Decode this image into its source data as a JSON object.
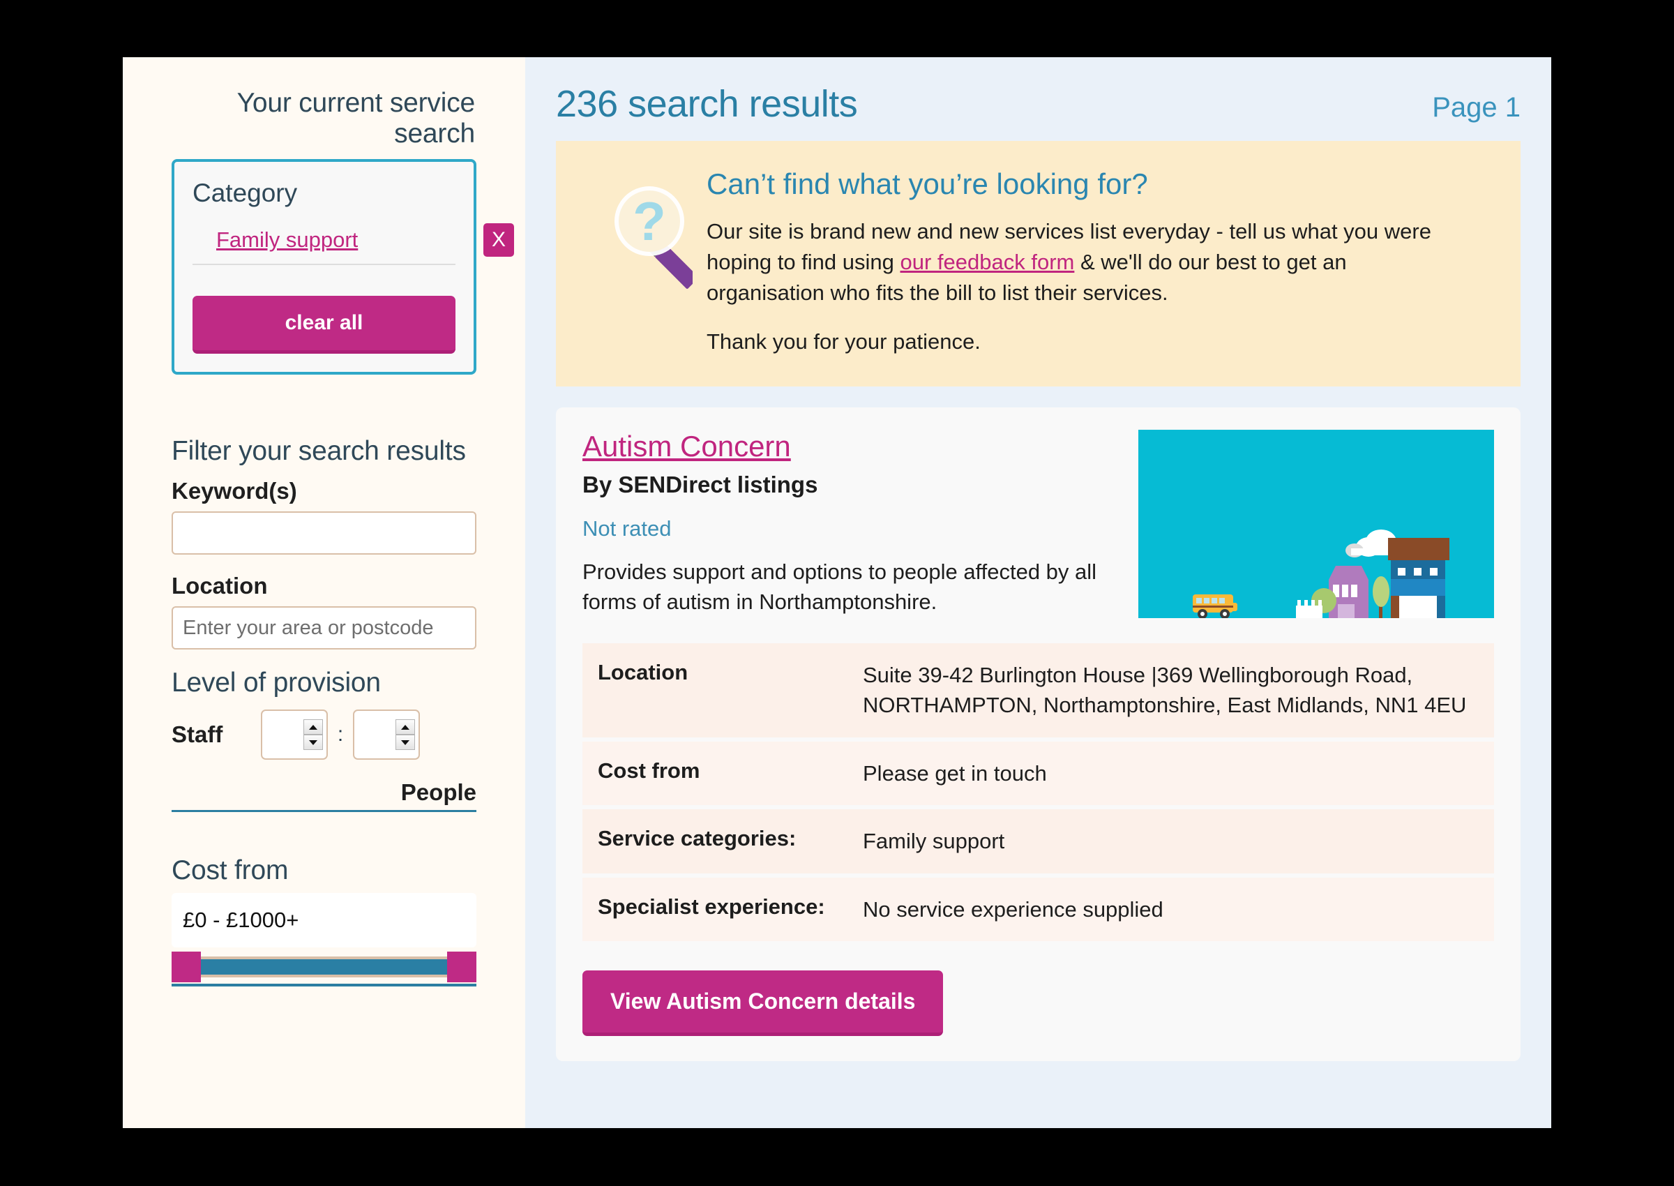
{
  "sidebar": {
    "current_search_title": "Your current service search",
    "category_label": "Category",
    "selected_category": "Family support",
    "remove_icon": "X",
    "clear_all_label": "clear all",
    "filter_title": "Filter your search results",
    "keywords_label": "Keyword(s)",
    "keywords_value": "",
    "keywords_placeholder": "",
    "location_label": "Location",
    "location_value": "",
    "location_placeholder": "Enter your area or postcode",
    "provision_title": "Level of provision",
    "staff_label": "Staff",
    "staff_ratio_left": "",
    "staff_ratio_right": "",
    "ratio_separator": ":",
    "people_label": "People",
    "cost_title": "Cost from",
    "cost_range_value": "£0 - £1000+"
  },
  "main": {
    "results_count": "236 search results",
    "page_indicator": "Page 1",
    "notice": {
      "icon": "magnifier-question-icon",
      "title": "Can’t find what you’re looking for?",
      "paragraph_1_before": "Our site is brand new and new services list everyday - tell us what you were hoping to find using ",
      "paragraph_1_link": "our feedback form",
      "paragraph_1_after": " & we'll do our best to get an organisation who fits the bill to list their services.",
      "paragraph_2": "Thank you for your patience."
    },
    "result": {
      "service_name": "Autism Concern",
      "provider": "By SENDirect listings",
      "rating": "Not rated",
      "description": "Provides support and options to people affected by all forms of autism in Northamptonshire.",
      "thumbnail": "town-illustration",
      "details": [
        {
          "key": "Location",
          "value": "Suite 39-42 Burlington House |369 Wellingborough Road, NORTHAMPTON, Northamptonshire, East Midlands, NN1 4EU"
        },
        {
          "key": "Cost from",
          "value": "Please get in touch"
        },
        {
          "key": "Service categories:",
          "value": "Family support"
        },
        {
          "key": "Specialist experience:",
          "value": "No service experience supplied"
        }
      ],
      "view_button_label": "View Autism Concern details"
    }
  },
  "colors": {
    "accent_magenta": "#bf2a85",
    "accent_teal": "#2fa8c8",
    "heading_blue": "#2a7fa4",
    "sidebar_bg": "#fffaf3",
    "main_bg": "#eaf1f9",
    "notice_bg": "#fcecca",
    "thumb_bg": "#06bbd4"
  }
}
